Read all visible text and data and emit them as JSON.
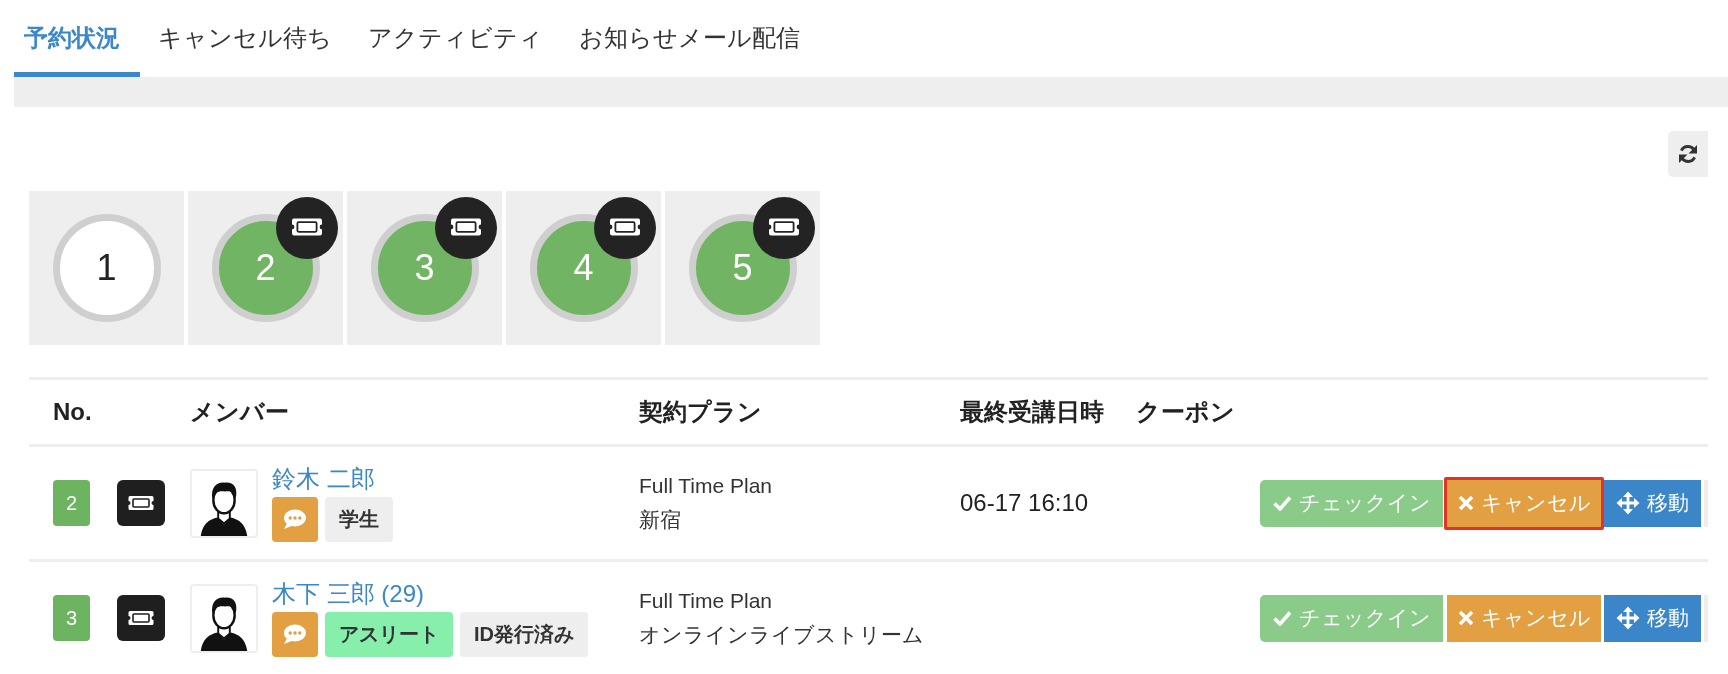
{
  "tabs": [
    {
      "label": "予約状況",
      "selected": true
    },
    {
      "label": "キャンセル待ち",
      "selected": false
    },
    {
      "label": "アクティビティ",
      "selected": false
    },
    {
      "label": "お知らせメール配信",
      "selected": false
    }
  ],
  "seats": [
    {
      "number": "1",
      "reserved": false,
      "ticket": false
    },
    {
      "number": "2",
      "reserved": true,
      "ticket": true
    },
    {
      "number": "3",
      "reserved": true,
      "ticket": true
    },
    {
      "number": "4",
      "reserved": true,
      "ticket": true
    },
    {
      "number": "5",
      "reserved": true,
      "ticket": true
    }
  ],
  "table": {
    "columns": [
      "No.",
      "メンバー",
      "契約プラン",
      "最終受講日時",
      "クーポン"
    ],
    "rows": [
      {
        "no": "2",
        "member": {
          "name": "鈴木 二郎",
          "tags": [
            {
              "label": "学生",
              "color": "#eeeeee"
            }
          ]
        },
        "plan": "Full Time Plan",
        "venue": "新宿",
        "last_attended": "06-17 16:10",
        "actions": [
          {
            "kind": "checkin",
            "label": "チェックイン",
            "disabled": true,
            "highlighted": false
          },
          {
            "kind": "cancel",
            "label": "キャンセル",
            "disabled": false,
            "highlighted": true
          },
          {
            "kind": "move",
            "label": "移動",
            "disabled": false,
            "highlighted": false
          }
        ]
      },
      {
        "no": "3",
        "member": {
          "name": "木下 三郎 (29)",
          "tags": [
            {
              "label": "アスリート",
              "color": "#86efab"
            },
            {
              "label": "ID発行済み",
              "color": "#eeeeee"
            }
          ]
        },
        "plan": "Full Time Plan",
        "venue": "オンラインライブストリーム",
        "actions": [
          {
            "kind": "checkin",
            "label": "チェックイン",
            "disabled": true,
            "highlighted": false
          },
          {
            "kind": "cancel",
            "label": "キャンセル",
            "disabled": false,
            "highlighted": false
          },
          {
            "kind": "move",
            "label": "移動",
            "disabled": false,
            "highlighted": false
          }
        ]
      }
    ]
  }
}
